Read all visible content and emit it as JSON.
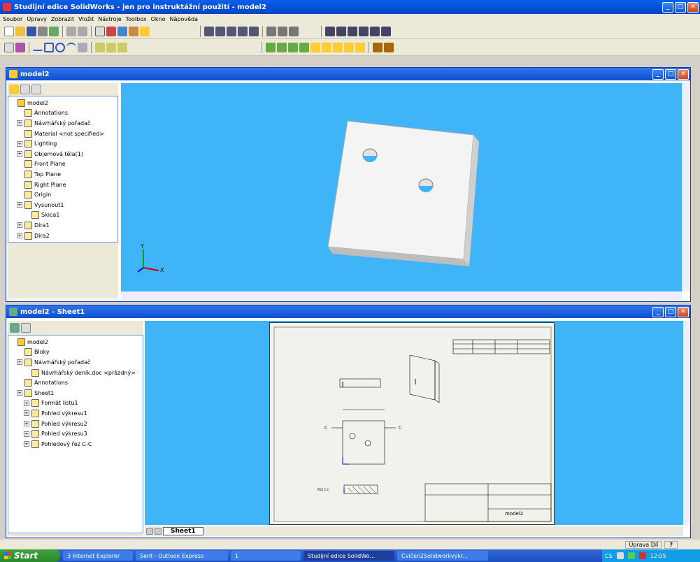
{
  "app": {
    "title": "Studijní edice SolidWorks - jen pro instruktážní použití - model2"
  },
  "menu": [
    "Soubor",
    "Úpravy",
    "Zobrazit",
    "Vložit",
    "Nástroje",
    "Toolbox",
    "Okno",
    "Nápověda"
  ],
  "part_window": {
    "title": "model2",
    "tree": [
      {
        "label": "model2",
        "level": 0
      },
      {
        "label": "Annotations",
        "level": 1
      },
      {
        "label": "Návrhářský pořadač",
        "level": 1,
        "expand": true
      },
      {
        "label": "Material <not specified>",
        "level": 1
      },
      {
        "label": "Lighting",
        "level": 1,
        "expand": true
      },
      {
        "label": "Objemová těla(1)",
        "level": 1,
        "expand": true
      },
      {
        "label": "Front Plane",
        "level": 1
      },
      {
        "label": "Top Plane",
        "level": 1
      },
      {
        "label": "Right Plane",
        "level": 1
      },
      {
        "label": "Origin",
        "level": 1
      },
      {
        "label": "Vysunout1",
        "level": 1,
        "expand": true
      },
      {
        "label": "Skica1",
        "level": 2
      },
      {
        "label": "Díra1",
        "level": 1,
        "expand": true
      },
      {
        "label": "Díra2",
        "level": 1,
        "expand": true
      }
    ]
  },
  "drawing_window": {
    "title": "model2 - Sheet1",
    "tree": [
      {
        "label": "model2",
        "level": 0
      },
      {
        "label": "Bloky",
        "level": 1
      },
      {
        "label": "Návrhářský pořadač",
        "level": 1,
        "expand": true
      },
      {
        "label": "Návrhářský deník.doc <prázdný>",
        "level": 2
      },
      {
        "label": "Annotations",
        "level": 1
      },
      {
        "label": "Sheet1",
        "level": 1,
        "expand": true
      },
      {
        "label": "Formát listu1",
        "level": 2,
        "expand": true
      },
      {
        "label": "Pohled výkresu1",
        "level": 2,
        "expand": true
      },
      {
        "label": "Pohled výkresu2",
        "level": 2,
        "expand": true
      },
      {
        "label": "Pohled výkresu3",
        "level": 2,
        "expand": true
      },
      {
        "label": "Pohledový řez C-C",
        "level": 2,
        "expand": true
      }
    ],
    "sheet_tab": "Sheet1",
    "title_block_name": "model2"
  },
  "status": {
    "mode": "Úprava Díl",
    "help": "?"
  },
  "taskbar": {
    "start": "Start",
    "items": [
      "3 Internet Explorer",
      "Sent - Outlook Express",
      "1",
      "Studijní edice SolidWo...",
      "Cvičen2Solidworkvýkr..."
    ],
    "lang": "CS",
    "clock": "12:05"
  },
  "colors": {
    "viewport": "#3fb5f8",
    "title": "#0a5fe8"
  }
}
